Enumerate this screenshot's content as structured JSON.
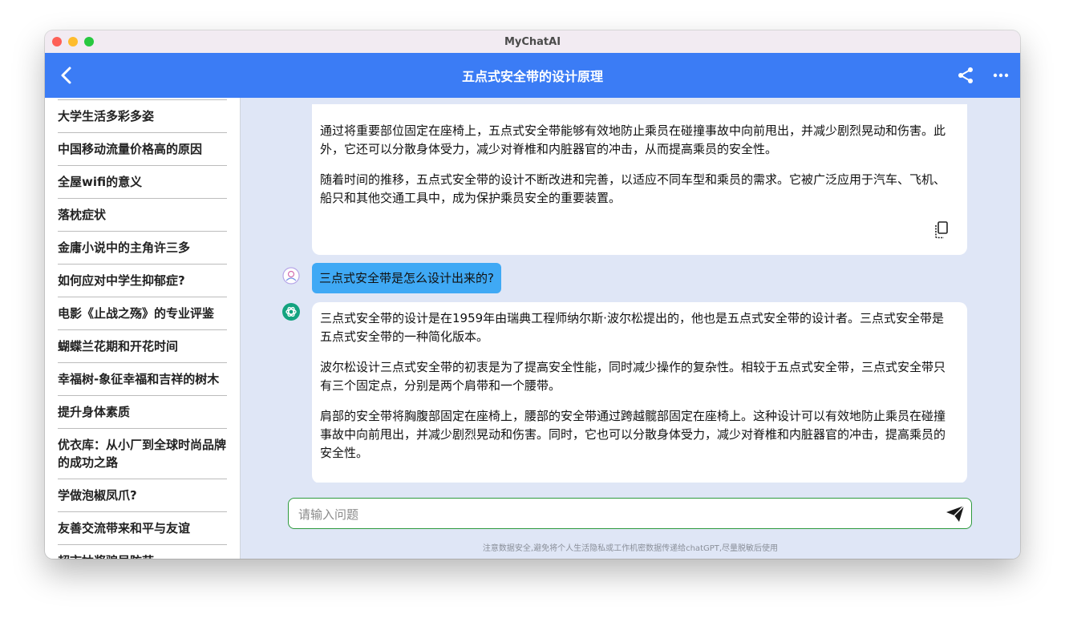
{
  "window": {
    "title": "MyChatAI"
  },
  "header": {
    "title": "五点式安全带的设计原理"
  },
  "sidebar": {
    "items": [
      {
        "label": "大学生活多彩多姿"
      },
      {
        "label": "中国移动流量价格高的原因"
      },
      {
        "label": "全屋wifi的意义"
      },
      {
        "label": "落枕症状"
      },
      {
        "label": "金庸小说中的主角许三多"
      },
      {
        "label": "如何应对中学生抑郁症?"
      },
      {
        "label": "电影《止战之殇》的专业评鉴"
      },
      {
        "label": "蝴蝶兰花期和开花时间"
      },
      {
        "label": "幸福树-象征幸福和吉祥的树木"
      },
      {
        "label": "提升身体素质"
      },
      {
        "label": "优衣库：从小厂到全球时尚品牌的成功之路"
      },
      {
        "label": "学做泡椒凤爪?"
      },
      {
        "label": "友善交流带来和平与友谊"
      },
      {
        "label": "超市抽奖骗局防范"
      }
    ]
  },
  "chat": {
    "ai_message_1": {
      "p1": "通过将重要部位固定在座椅上，五点式安全带能够有效地防止乘员在碰撞事故中向前甩出，并减少剧烈晃动和伤害。此外，它还可以分散身体受力，减少对脊椎和内脏器官的冲击，从而提高乘员的安全性。",
      "p2": "随着时间的推移，五点式安全带的设计不断改进和完善，以适应不同车型和乘员的需求。它被广泛应用于汽车、飞机、船只和其他交通工具中，成为保护乘员安全的重要装置。"
    },
    "user_message": "三点式安全带是怎么设计出来的?",
    "ai_message_2": {
      "p1": "三点式安全带的设计是在1959年由瑞典工程师纳尔斯·波尔松提出的，他也是五点式安全带的设计者。三点式安全带是五点式安全带的一种简化版本。",
      "p2": "波尔松设计三点式安全带的初衷是为了提高安全性能，同时减少操作的复杂性。相较于五点式安全带，三点式安全带只有三个固定点，分别是两个肩带和一个腰带。",
      "p3": "肩部的安全带将胸腹部固定在座椅上，腰部的安全带通过跨越髋部固定在座椅上。这种设计可以有效地防止乘员在碰撞事故中向前甩出，并减少剧烈晃动和伤害。同时，它也可以分散身体受力，减少对脊椎和内脏器官的冲击，提高乘员的安全性。"
    }
  },
  "input": {
    "placeholder": "请输入问题",
    "value": ""
  },
  "footer": {
    "notice": "注意数据安全,避免将个人生活隐私或工作机密数据传递给chatGPT,尽量脱敏后使用"
  },
  "colors": {
    "appbar": "#3b7cf5",
    "user_bubble": "#3fa9f5",
    "chat_bg": "#dfe6f6",
    "input_border": "#2e9a3e"
  },
  "icons": [
    "back-arrow-icon",
    "share-icon",
    "more-icon",
    "copy-icon",
    "user-avatar-icon",
    "chatgpt-logo-icon",
    "send-icon"
  ]
}
